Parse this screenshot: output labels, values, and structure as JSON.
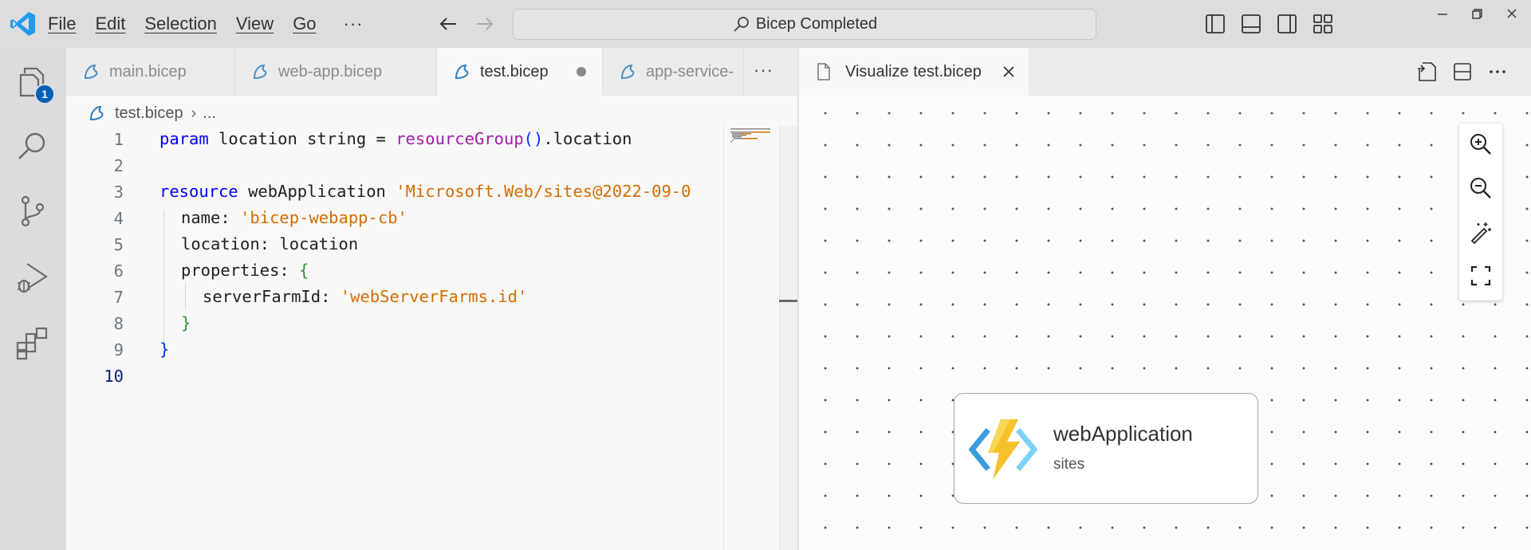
{
  "menu": {
    "items": [
      "File",
      "Edit",
      "Selection",
      "View",
      "Go"
    ],
    "more": "···"
  },
  "command_center": {
    "text": "Bicep Completed"
  },
  "activity": {
    "explorer_badge": "1"
  },
  "editor": {
    "tabs": [
      {
        "label": "main.bicep",
        "active": false
      },
      {
        "label": "web-app.bicep",
        "active": false
      },
      {
        "label": "test.bicep",
        "active": true,
        "dirty": true
      },
      {
        "label": "app-service-",
        "active": false
      }
    ],
    "tabs_more": "···",
    "breadcrumb": {
      "file": "test.bicep",
      "sep": "›",
      "more": "..."
    },
    "lines": [
      {
        "n": "1"
      },
      {
        "n": "2"
      },
      {
        "n": "3"
      },
      {
        "n": "4"
      },
      {
        "n": "5"
      },
      {
        "n": "6"
      },
      {
        "n": "7"
      },
      {
        "n": "8"
      },
      {
        "n": "9"
      },
      {
        "n": "10"
      }
    ],
    "code": {
      "l1_kw": "param",
      "l1_rest": " location string = ",
      "l1_fn": "resourceGroup",
      "l1_paren": "()",
      "l1_tail": ".location",
      "l3_kw": "resource",
      "l3_name": " webApplication ",
      "l3_str": "'Microsoft.Web/sites@2022-09-0",
      "l4_key": "name: ",
      "l4_str": "'bicep-webapp-cb'",
      "l5_text": "location: location",
      "l6_key": "properties: ",
      "l6_brace": "{",
      "l7_key": "serverFarmId: ",
      "l7_str": "'webServerFarms.id'",
      "l8_brace": "}",
      "l9_brace": "}"
    }
  },
  "visualizer": {
    "tab_label": "Visualize test.bicep",
    "node": {
      "title": "webApplication",
      "subtitle": "sites"
    }
  },
  "colors": {
    "accent": "#005fb8",
    "keyword": "#0000ff",
    "string": "#d46d00",
    "function": "#9e1ea8"
  }
}
